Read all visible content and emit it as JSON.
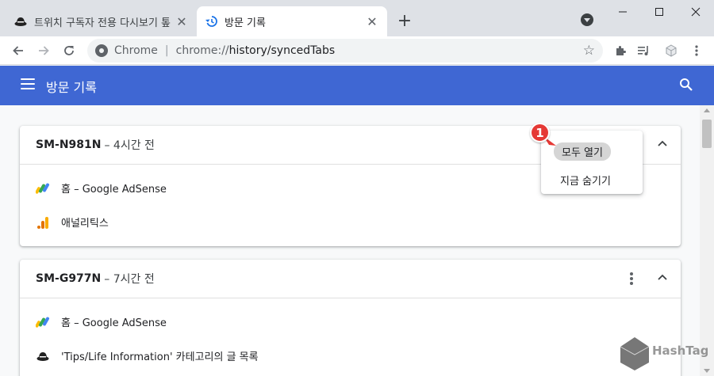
{
  "tabs": [
    {
      "title": "트위치 구독자 전용 다시보기 톺",
      "icon": "hat-favicon",
      "active": false
    },
    {
      "title": "방문 기록",
      "icon": "history-icon",
      "active": true
    }
  ],
  "toolbar": {
    "scheme_label": "Chrome",
    "url_host": "chrome://",
    "url_path": "history/syncedTabs"
  },
  "header": {
    "title": "방문 기록"
  },
  "cards": [
    {
      "device": "SM-N981N",
      "time": "– 4시간 전",
      "items": [
        {
          "label": "홈 – Google AdSense",
          "icon": "adsense-icon"
        },
        {
          "label": "애널리틱스",
          "icon": "analytics-icon"
        }
      ]
    },
    {
      "device": "SM-G977N",
      "time": "– 7시간 전",
      "items": [
        {
          "label": "홈 – Google AdSense",
          "icon": "adsense-icon"
        },
        {
          "label": "'Tips/Life Information' 카테고리의 글 목록",
          "icon": "hat-favicon"
        }
      ]
    }
  ],
  "menu": {
    "open_all": "모두 열기",
    "hide_now": "지금 숨기기"
  },
  "callout": {
    "number": "1",
    "color": "#e53935"
  },
  "colors": {
    "header_blue": "#3f67d3",
    "tab_strip": "#dee1e6"
  }
}
